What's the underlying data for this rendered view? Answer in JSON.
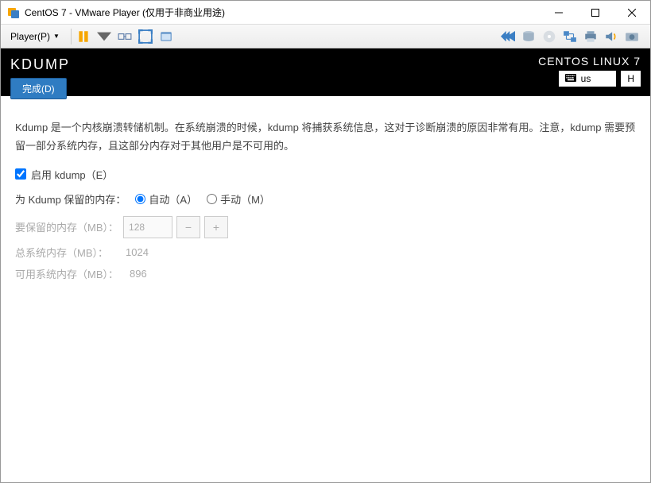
{
  "titlebar": {
    "text": "CentOS 7 - VMware Player (仅用于非商业用途)"
  },
  "menubar": {
    "player": "Player(P)"
  },
  "anaconda": {
    "page_title": "KDUMP",
    "done": "完成(D)",
    "distro": "CENTOS LINUX 7",
    "keyboard": "us",
    "help": "H",
    "description": "Kdump 是一个内核崩溃转储机制。在系统崩溃的时候，kdump 将捕获系统信息，这对于诊断崩溃的原因非常有用。注意，kdump 需要预留一部分系统内存，且这部分内存对于其他用户是不可用的。",
    "enable_label": "启用 kdump（E）",
    "reserve_label": "为 Kdump 保留的内存：",
    "auto_label": "自动（A）",
    "manual_label": "手动（M）",
    "reserve_amount_label": "要保留的内存（MB）：",
    "reserve_value": "128",
    "total_mem_label": "总系统内存（MB）：",
    "total_mem_value": "1024",
    "usable_mem_label": "可用系统内存（MB）：",
    "usable_mem_value": "896"
  }
}
